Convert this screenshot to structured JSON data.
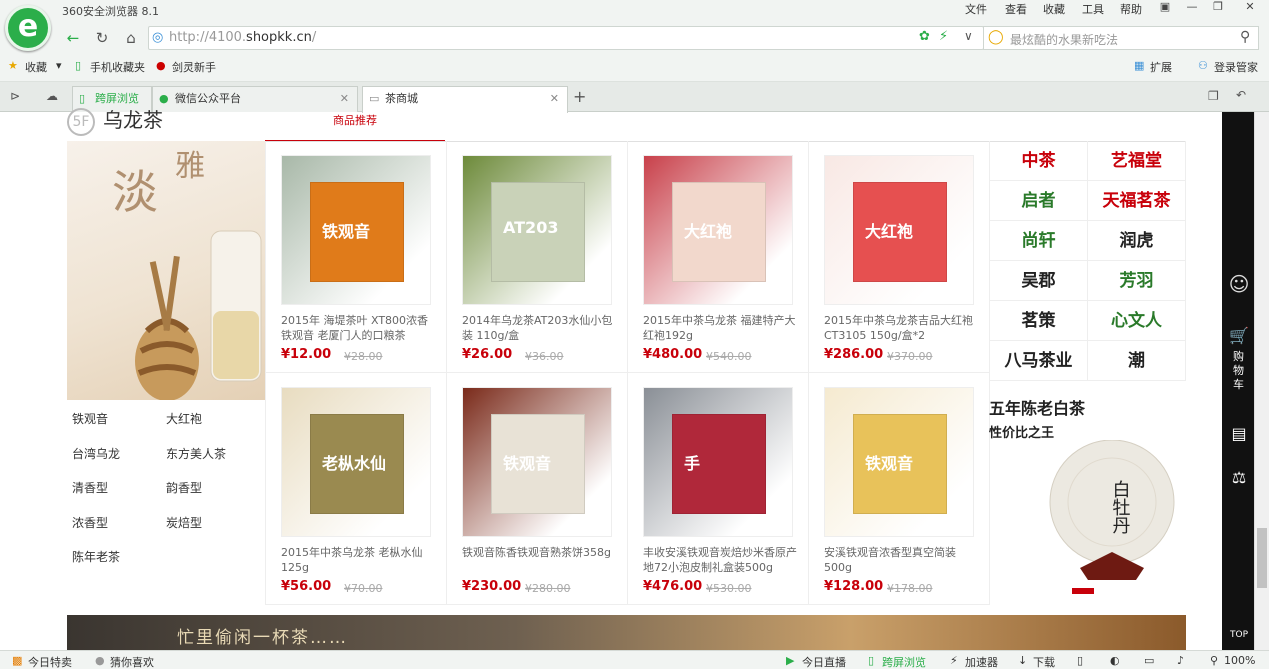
{
  "browser": {
    "app_title": "360安全浏览器 8.1",
    "menu": [
      "文件",
      "查看",
      "收藏",
      "工具",
      "帮助"
    ],
    "url_prefix": "http://4100.",
    "url_domain": "shopkk.cn",
    "url_suffix": "/",
    "search_placeholder": "最炫酷的水果新吃法",
    "bookmarks": {
      "favorites": "收藏",
      "mobile": "手机收藏夹",
      "jianling": "剑灵新手"
    },
    "extension": "扩展",
    "login": "登录管家",
    "tabs": [
      "跨屏浏览",
      "微信公众平台",
      "茶商城"
    ]
  },
  "floor": {
    "badge": "5F",
    "title": "乌龙茶",
    "tab_recommend": "商品推荐"
  },
  "banner": {
    "text1": "淡",
    "text2": "雅"
  },
  "categories": [
    "铁观音",
    "大红袍",
    "台湾乌龙",
    "东方美人茶",
    "清香型",
    "韵香型",
    "浓香型",
    "炭焙型",
    "陈年老茶"
  ],
  "products": [
    {
      "name": "2015年 海堤茶叶 XT800浓香铁观音 老厦门人的口粮茶",
      "price": "¥12.00",
      "old": "¥28.00",
      "img": "铁观音"
    },
    {
      "name": "2014年乌龙茶AT203水仙小包装 110g/盒",
      "price": "¥26.00",
      "old": "¥36.00",
      "img": "AT203"
    },
    {
      "name": "2015年中茶乌龙茶 福建特产大红袍192g",
      "price": "¥480.00",
      "old": "¥540.00",
      "img": "大红袍"
    },
    {
      "name": "2015年中茶乌龙茶吉品大红袍CT3105 150g/盒*2",
      "price": "¥286.00",
      "old": "¥370.00",
      "img": "大红袍"
    },
    {
      "name": "2015年中茶乌龙茶 老枞水仙125g",
      "price": "¥56.00",
      "old": "¥70.00",
      "img": "老枞水仙"
    },
    {
      "name": "铁观音陈香铁观音熟茶饼358g",
      "price": "¥230.00",
      "old": "¥280.00",
      "img": "铁观音"
    },
    {
      "name": "丰收安溪铁观音炭焙炒米香原产地72小泡皮制礼盒装500g",
      "price": "¥476.00",
      "old": "¥530.00",
      "img": "手"
    },
    {
      "name": "安溪铁观音浓香型真空简装500g",
      "price": "¥128.00",
      "old": "¥178.00",
      "img": "铁观音"
    }
  ],
  "brands": [
    "中茶",
    "艺福堂",
    "启者",
    "天福茗茶",
    "尚轩",
    "润虎",
    "吴郡",
    "芳羽",
    "茗策",
    "心文人",
    "八马茶业",
    "潮"
  ],
  "promo": {
    "title": "五年陈老白茶",
    "subtitle": "性价比之王",
    "cake_text": "白牡丹"
  },
  "strip_text": "忙里偷闲一杯茶……",
  "rail": {
    "cart": "购物车",
    "top": "TOP"
  },
  "status": {
    "today_deal": "今日特卖",
    "guess": "猜你喜欢",
    "live": "今日直播",
    "cross": "跨屏浏览",
    "accel": "加速器",
    "download": "下载",
    "zoom": "100%"
  }
}
